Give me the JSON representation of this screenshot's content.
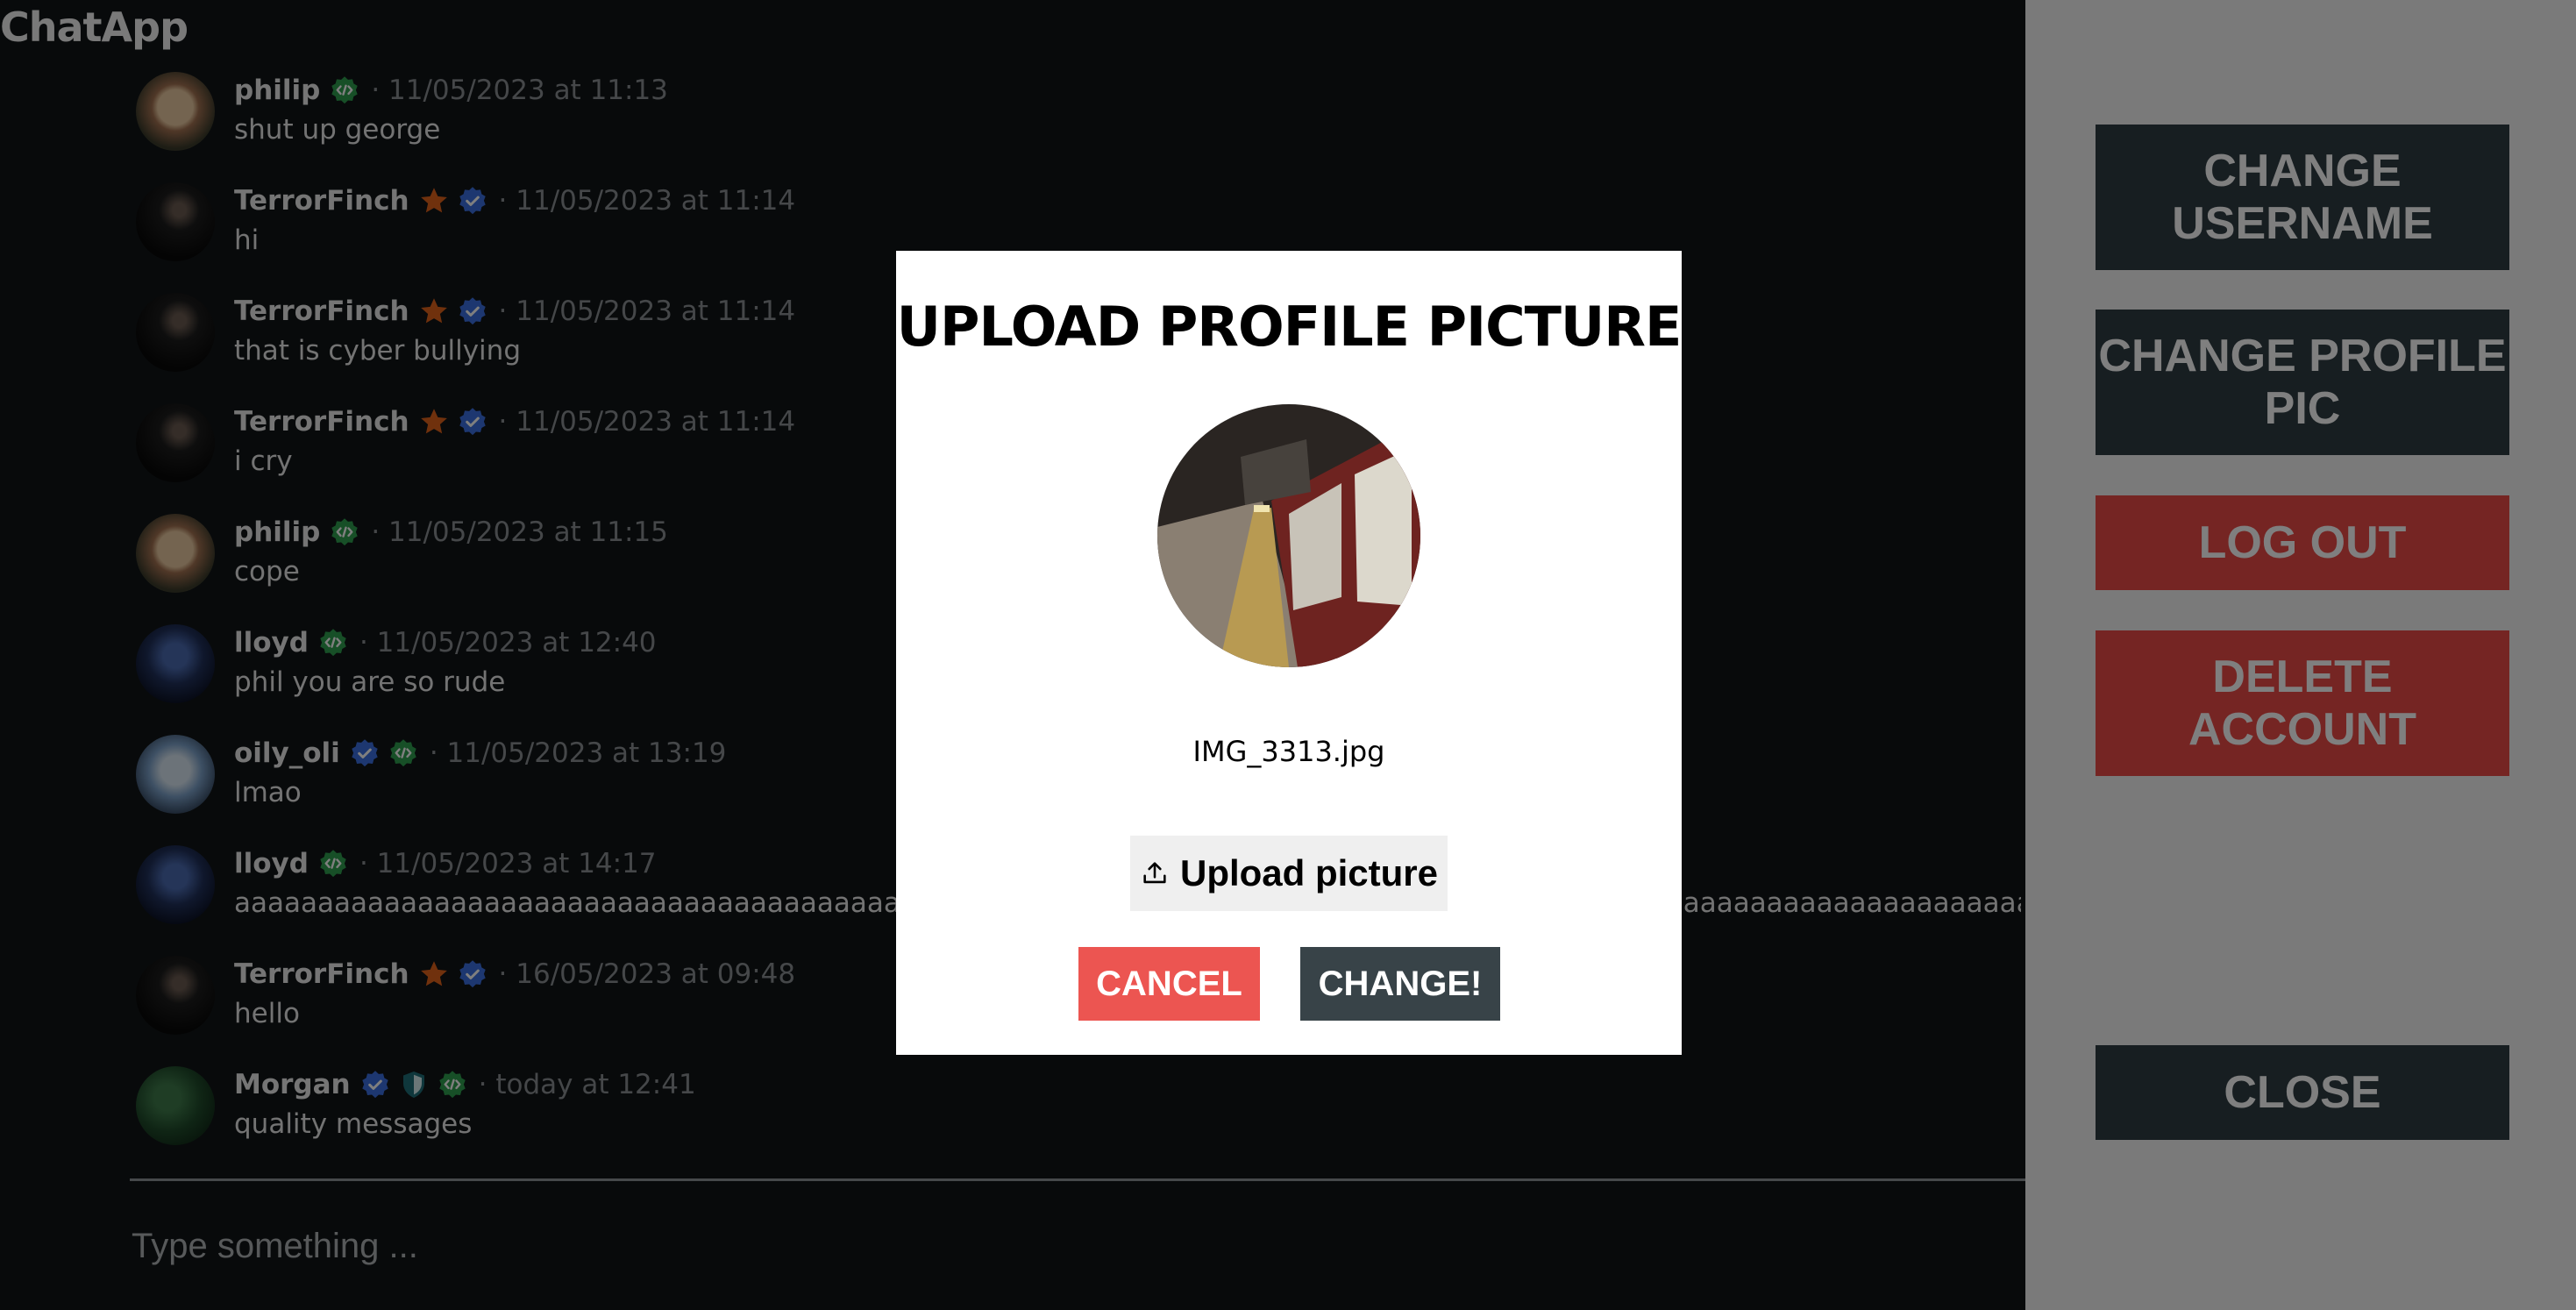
{
  "app": {
    "title": "ChatApp"
  },
  "messages": [
    {
      "username": "philip",
      "badges": [
        "dev"
      ],
      "timestamp": "· 11/05/2023 at 11:13",
      "text": "shut up george",
      "avatar": "philip"
    },
    {
      "username": "TerrorFinch",
      "badges": [
        "star",
        "verified"
      ],
      "timestamp": "· 11/05/2023 at 11:14",
      "text": "hi",
      "avatar": "terror"
    },
    {
      "username": "TerrorFinch",
      "badges": [
        "star",
        "verified"
      ],
      "timestamp": "· 11/05/2023 at 11:14",
      "text": "that is cyber bullying",
      "avatar": "terror"
    },
    {
      "username": "TerrorFinch",
      "badges": [
        "star",
        "verified"
      ],
      "timestamp": "· 11/05/2023 at 11:14",
      "text": "i cry",
      "avatar": "terror"
    },
    {
      "username": "philip",
      "badges": [
        "dev"
      ],
      "timestamp": "· 11/05/2023 at 11:15",
      "text": "cope",
      "avatar": "philip"
    },
    {
      "username": "lloyd",
      "badges": [
        "dev"
      ],
      "timestamp": "· 11/05/2023 at 12:40",
      "text": "phil you are so rude",
      "avatar": "lloyd"
    },
    {
      "username": "oily_oli",
      "badges": [
        "verified",
        "dev"
      ],
      "timestamp": "· 11/05/2023 at 13:19",
      "text": "lmao",
      "avatar": "oli"
    },
    {
      "username": "lloyd",
      "badges": [
        "dev"
      ],
      "timestamp": "· 11/05/2023 at 14:17",
      "text": "aaaaaaaaaaaaaaaaaaaaaaaaaaaaaaaaaaaaaaaaaaaaaaaaaaaaaaaaaaaaaaaaaaaaaaaaaaaaaaaaaaaaaaaaaaaaaaaaaaaaaaaaaaaaaaaaaaaaaaaaaaaaaaaaaaaaaaaaaaaaaaaaaaaaaaaaaaaaaaaaaaaaaaaaaaaaaaaaaaaaaaaaaaaaaaaaaaaaaaaaaaaaaaaa",
      "avatar": "lloyd"
    },
    {
      "username": "TerrorFinch",
      "badges": [
        "star",
        "verified"
      ],
      "timestamp": "· 16/05/2023 at 09:48",
      "text": "hello",
      "avatar": "terror"
    },
    {
      "username": "Morgan",
      "badges": [
        "verified",
        "shield",
        "dev"
      ],
      "timestamp": "· today at 12:41",
      "text": "quality messages",
      "avatar": "morgan"
    }
  ],
  "composer": {
    "placeholder": "Type something ..."
  },
  "sidebar": {
    "change_username": "CHANGE USERNAME",
    "change_profile_pic": "CHANGE PROFILE PIC",
    "log_out": "LOG OUT",
    "delete_account": "DELETE ACCOUNT",
    "close": "CLOSE"
  },
  "modal": {
    "title": "UPLOAD PROFILE PICTURE",
    "filename": "IMG_3313.jpg",
    "upload_label": "Upload picture",
    "cancel_label": "CANCEL",
    "change_label": "CHANGE!"
  },
  "colors": {
    "background": "#101416",
    "side_panel": "#f4f4f4",
    "dark_button": "#2f3c42",
    "red_button": "#ea4a46",
    "cancel": "#ec5551",
    "change": "#384348",
    "badge_dev": "#2e9e4f",
    "badge_verified": "#3a6fe0",
    "badge_star": "#e0621b"
  }
}
